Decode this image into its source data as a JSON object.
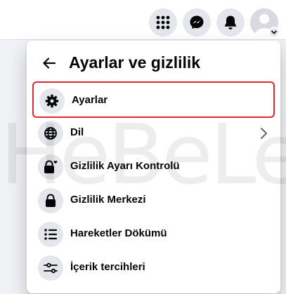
{
  "menu": {
    "title": "Ayarlar ve gizlilik",
    "items": [
      {
        "label": "Ayarlar",
        "icon": "gear-icon",
        "highlighted": true
      },
      {
        "label": "Dil",
        "icon": "globe-icon",
        "has_submenu": true
      },
      {
        "label": "Gizlilik Ayarı Kontrolü",
        "icon": "lock-heart-icon"
      },
      {
        "label": "Gizlilik Merkezi",
        "icon": "lock-icon"
      },
      {
        "label": "Hareketler Dökümü",
        "icon": "list-icon"
      },
      {
        "label": "İçerik tercihleri",
        "icon": "sliders-icon"
      }
    ]
  },
  "topbar": {
    "icons": [
      "grid-menu-icon",
      "messenger-icon",
      "bell-icon",
      "avatar"
    ]
  },
  "watermark": {
    "text": "HeBeLe"
  },
  "colors": {
    "highlight_border": "#e0262e",
    "icon_bg": "#e4e6eb",
    "text": "#050505"
  }
}
